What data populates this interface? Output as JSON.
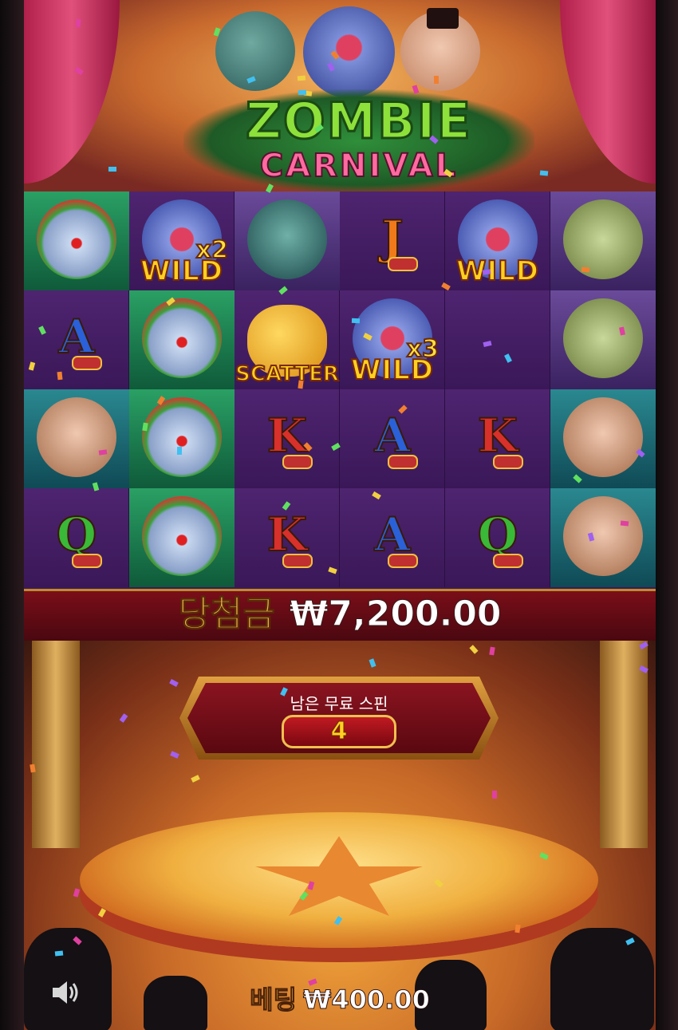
{
  "game": {
    "title": "ZOMBIE",
    "subtitle": "CARNIVAL"
  },
  "reels": {
    "wild_label": "WILD",
    "scatter_label": "SCATTER",
    "multipliers": [
      "x2",
      "x3"
    ],
    "letters": [
      "A",
      "K",
      "Q",
      "J"
    ],
    "cells": [
      {
        "col": 0,
        "row": 0,
        "symbol": "clown"
      },
      {
        "col": 1,
        "row": 0,
        "symbol": "bear-wild",
        "multiplier": "x2"
      },
      {
        "col": 2,
        "row": 0,
        "symbol": "zombie"
      },
      {
        "col": 3,
        "row": 0,
        "symbol": "J"
      },
      {
        "col": 4,
        "row": 0,
        "symbol": "bear-wild"
      },
      {
        "col": 5,
        "row": 0,
        "symbol": "old-man"
      },
      {
        "col": 0,
        "row": 1,
        "symbol": "A"
      },
      {
        "col": 1,
        "row": 1,
        "symbol": "clown"
      },
      {
        "col": 2,
        "row": 1,
        "symbol": "brain-scatter"
      },
      {
        "col": 3,
        "row": 1,
        "symbol": "bear-wild",
        "multiplier": "x3"
      },
      {
        "col": 5,
        "row": 1,
        "symbol": "old-man"
      },
      {
        "col": 0,
        "row": 2,
        "symbol": "ringmaster"
      },
      {
        "col": 1,
        "row": 2,
        "symbol": "clown"
      },
      {
        "col": 2,
        "row": 2,
        "symbol": "K"
      },
      {
        "col": 3,
        "row": 2,
        "symbol": "A"
      },
      {
        "col": 4,
        "row": 2,
        "symbol": "K"
      },
      {
        "col": 5,
        "row": 2,
        "symbol": "ringmaster"
      },
      {
        "col": 0,
        "row": 3,
        "symbol": "Q"
      },
      {
        "col": 1,
        "row": 3,
        "symbol": "clown"
      },
      {
        "col": 2,
        "row": 3,
        "symbol": "K"
      },
      {
        "col": 3,
        "row": 3,
        "symbol": "A"
      },
      {
        "col": 4,
        "row": 3,
        "symbol": "Q"
      },
      {
        "col": 5,
        "row": 3,
        "symbol": "ringmaster"
      }
    ]
  },
  "win": {
    "label": "당첨금",
    "amount": "₩7,200.00"
  },
  "free_spins": {
    "label": "남은 무료 스핀",
    "remaining": "4"
  },
  "bet": {
    "label": "베팅",
    "amount": "₩400.00"
  },
  "icons": {
    "sound": "speaker-icon"
  },
  "colors": {
    "gold": "#ffd020",
    "win_label": "#f0b84a",
    "panel_red": "#8a1420",
    "reel_bg": "#3d1a54"
  }
}
